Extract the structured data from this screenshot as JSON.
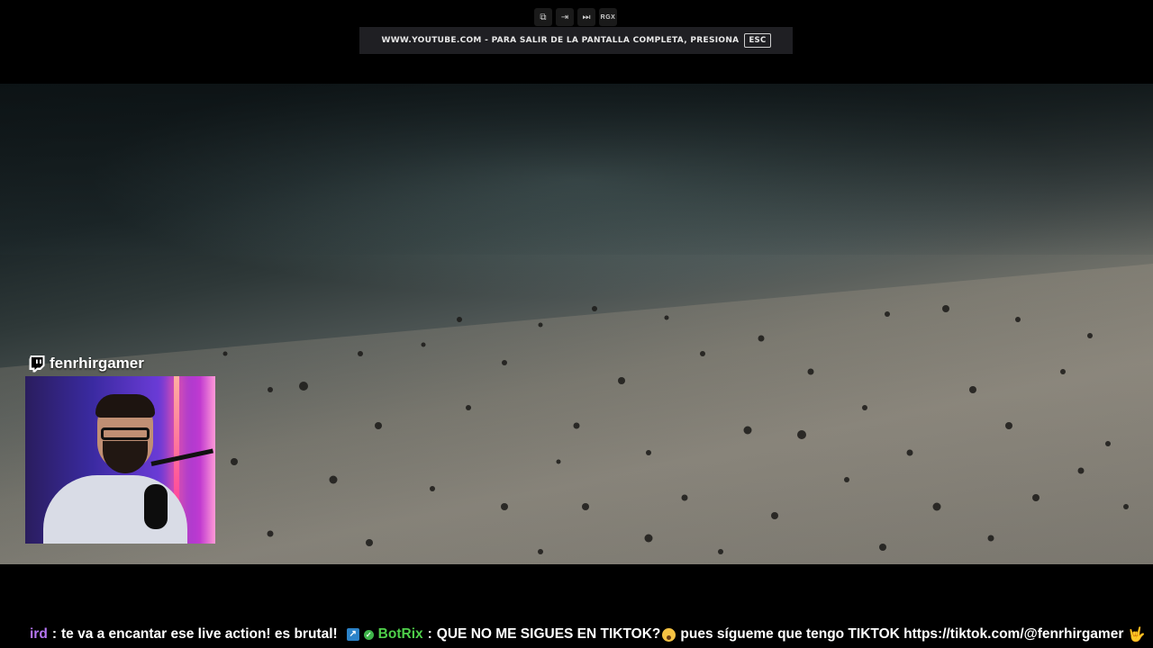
{
  "toolbar": {
    "icons": [
      "popout-icon",
      "enter-icon",
      "skip-icon",
      "rgx-extension-icon"
    ],
    "rgx_label": "RGX"
  },
  "fullscreen_banner": {
    "message": "WWW.YOUTUBE.COM - PARA SALIR DE LA PANTALLA COMPLETA, PRESIONA",
    "key": "ESC"
  },
  "overlay": {
    "channel_name": "fenrhirgamer",
    "accent_color": "#9146ff"
  },
  "chat": {
    "message1": {
      "user": "ird",
      "separator": ":",
      "text": "te va a encantar ese live action! es brutal!"
    },
    "message2": {
      "user": "BotRix",
      "separator": ":",
      "text_part1": "QUE NO ME SIGUES EN TIKTOK?",
      "text_part2": "pues sígueme que tengo TIKTOK https://tiktok.com/@fenrhirgamer"
    },
    "colors": {
      "user1": "#b676f4",
      "bot": "#4fd04a"
    }
  }
}
